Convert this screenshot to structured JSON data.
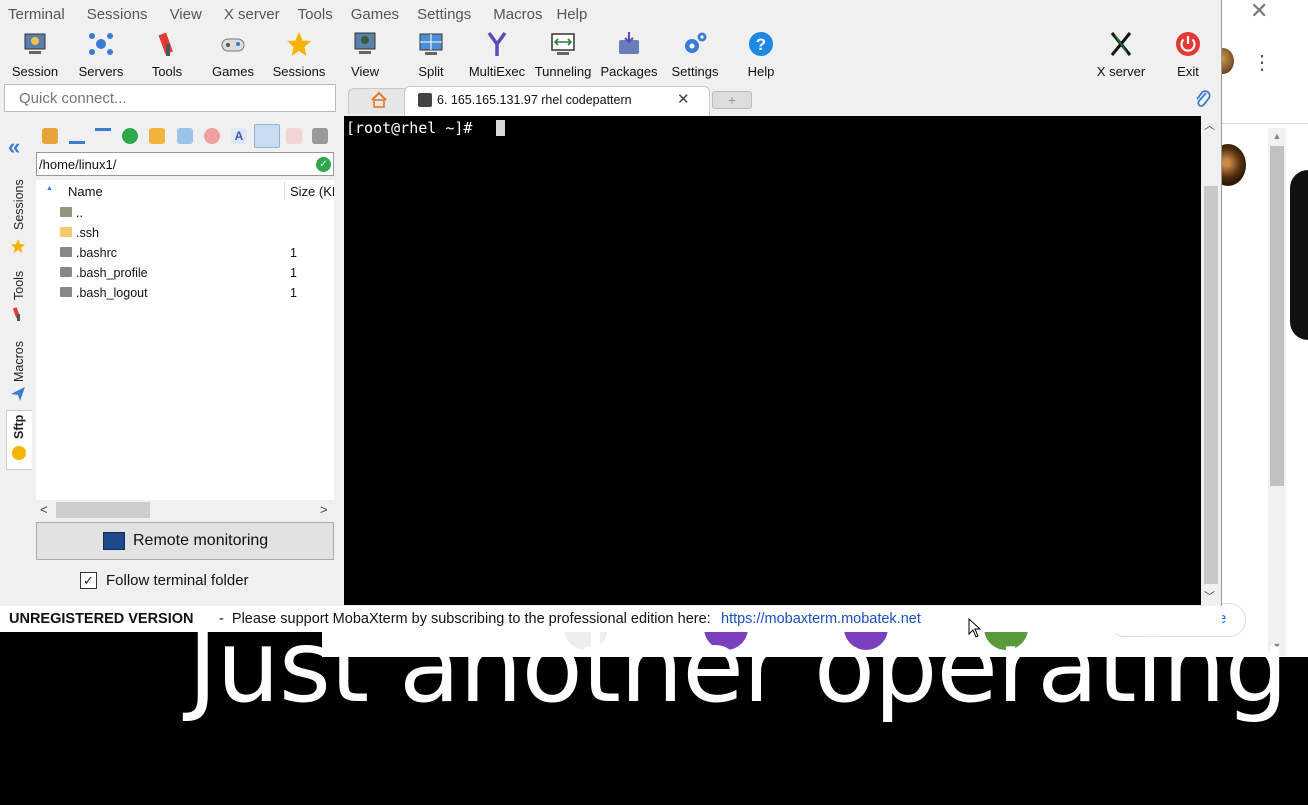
{
  "app": {
    "menu": [
      "Terminal",
      "Sessions",
      "View",
      "X server",
      "Tools",
      "Games",
      "Settings",
      "Macros",
      "Help"
    ]
  },
  "toolbar": {
    "session": "Session",
    "servers": "Servers",
    "tools": "Tools",
    "games": "Games",
    "sessions": "Sessions",
    "view": "View",
    "split": "Split",
    "multiexec": "MultiExec",
    "tunneling": "Tunneling",
    "packages": "Packages",
    "settings": "Settings",
    "help": "Help",
    "xserver": "X server",
    "exit": "Exit"
  },
  "quick_connect": {
    "placeholder": "Quick connect..."
  },
  "tabs": {
    "active_label": "6. 165.165.131.97 rhel codepattern",
    "new_tab_glyph": "+"
  },
  "side_tabs": [
    "Sessions",
    "Tools",
    "Macros",
    "Sftp"
  ],
  "sftp": {
    "path": "/home/linux1/",
    "columns": {
      "name": "Name",
      "size": "Size (KB)"
    },
    "files": [
      {
        "name": "..",
        "size": "",
        "icon": "parent-folder-icon"
      },
      {
        "name": ".ssh",
        "size": "",
        "icon": "folder-icon"
      },
      {
        "name": ".bashrc",
        "size": "1",
        "icon": "file-icon"
      },
      {
        "name": ".bash_profile",
        "size": "1",
        "icon": "file-icon"
      },
      {
        "name": ".bash_logout",
        "size": "1",
        "icon": "file-icon"
      }
    ],
    "remote_monitoring": "Remote monitoring",
    "follow_terminal_folder": "Follow terminal folder",
    "follow_checked": true
  },
  "terminal": {
    "prompt": "[root@rhel ~]# "
  },
  "status": {
    "unregistered": "UNREGISTERED VERSION",
    "message": " -  Please support MobaXterm by subscribing to the professional edition here:",
    "link": "https://mobaxterm.mobatek.net"
  },
  "background": {
    "hero_text": "Just another operating s",
    "pill_text": "e"
  },
  "colors": {
    "accent": "#3a7bd5",
    "exit_red": "#e53935",
    "help_blue": "#1e88e5",
    "link": "#1a4fbf"
  }
}
